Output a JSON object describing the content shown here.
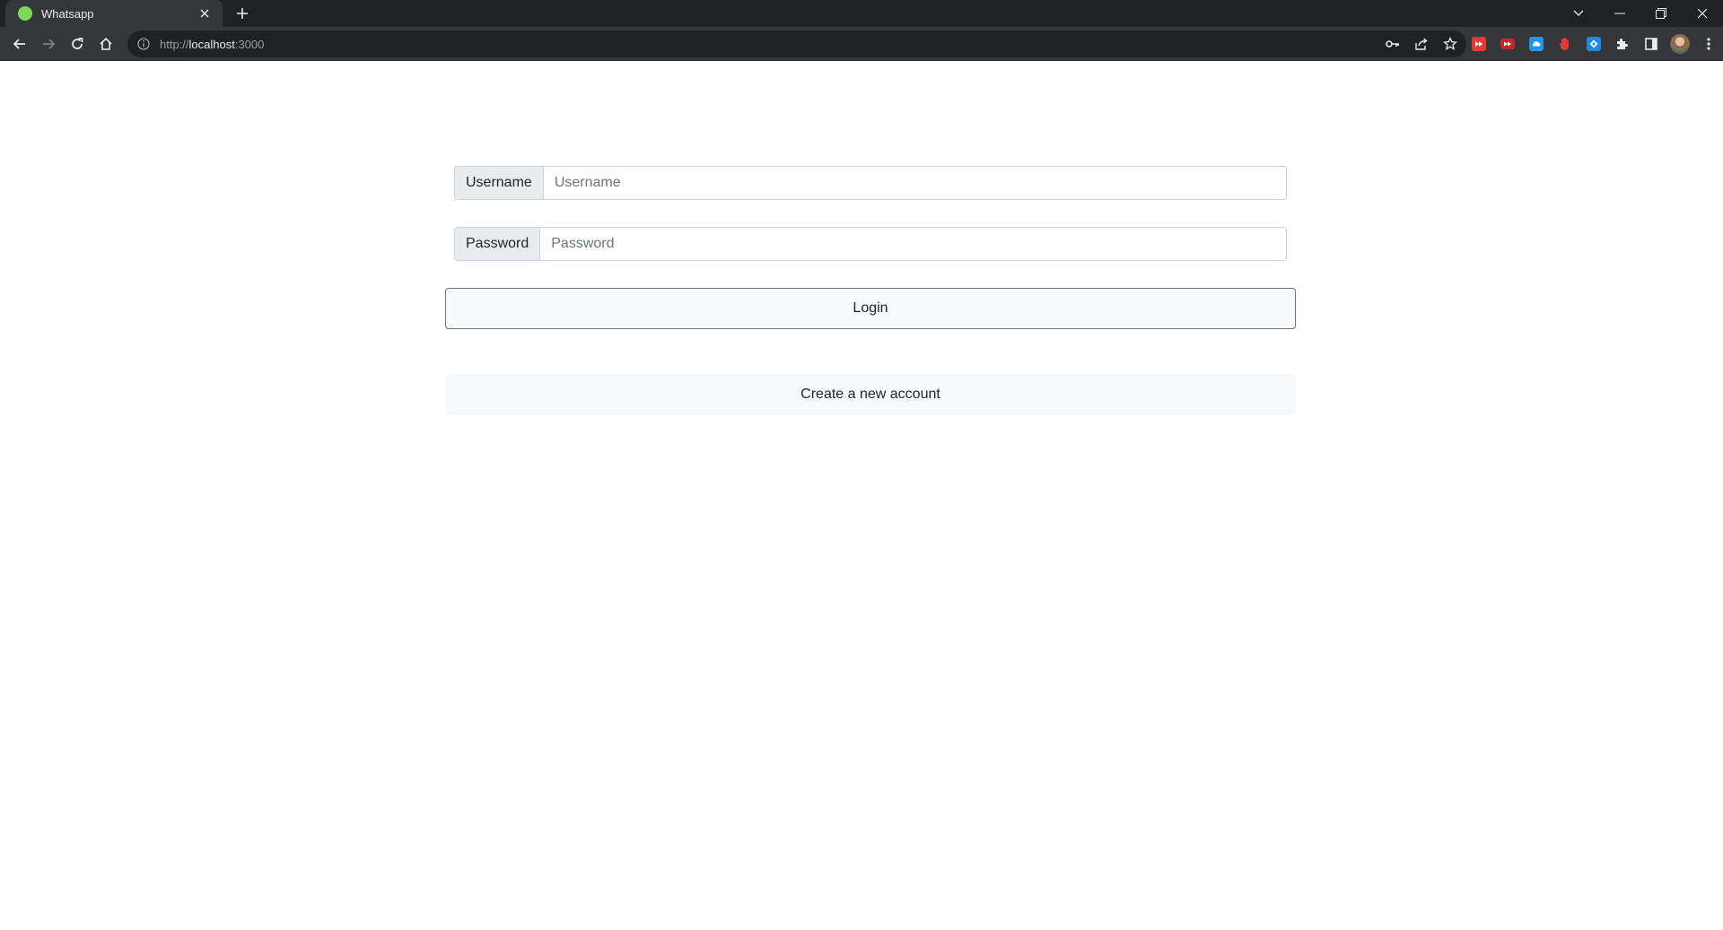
{
  "browser": {
    "tab": {
      "title": "Whatsapp",
      "favicon_color": "#7ed957"
    },
    "address": {
      "scheme": "http://",
      "host": "localhost",
      "port": ":3000"
    },
    "icons": {
      "back": "arrow-left-icon",
      "forward": "arrow-right-icon",
      "reload": "reload-icon",
      "home": "home-icon",
      "info": "info-icon",
      "key": "key-icon",
      "share": "share-icon",
      "bookmark": "star-icon",
      "extensions": "puzzle-icon",
      "side_panel": "side-panel-icon",
      "menu": "kebab-menu-icon"
    },
    "extension_colors": [
      "#e53935",
      "#c62828",
      "#2196f3",
      "#e53935",
      "#1e88e5"
    ]
  },
  "login_form": {
    "username": {
      "label": "Username",
      "placeholder": "Username",
      "value": ""
    },
    "password": {
      "label": "Password",
      "placeholder": "Password",
      "value": ""
    },
    "login_button": "Login",
    "create_account_link": "Create a new account"
  }
}
